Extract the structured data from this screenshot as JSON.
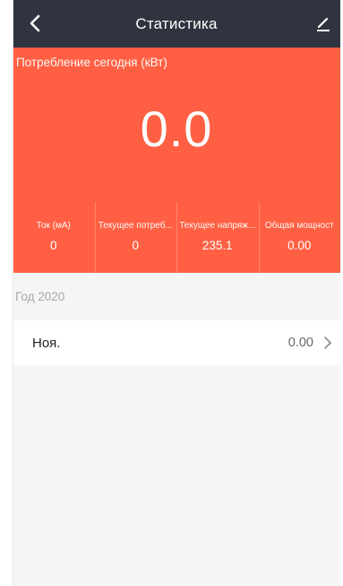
{
  "navbar": {
    "title": "Статистика",
    "back_icon": "back-arrow-icon",
    "edit_icon": "pencil-edit-icon",
    "background": "#2f3440"
  },
  "hero": {
    "label": "Потребление сегодня (кВт)",
    "value": "0.0",
    "background": "#ff6043"
  },
  "stats": [
    {
      "label": "Ток (мА)",
      "value": "0"
    },
    {
      "label": "Текущее потреб...",
      "value": "0"
    },
    {
      "label": "Текущее напряж...",
      "value": "235.1"
    },
    {
      "label": "Общая мощност",
      "value": "0.00"
    }
  ],
  "history": {
    "year_label": "Год 2020",
    "months": [
      {
        "name": "Ноя.",
        "value": "0.00"
      }
    ]
  }
}
